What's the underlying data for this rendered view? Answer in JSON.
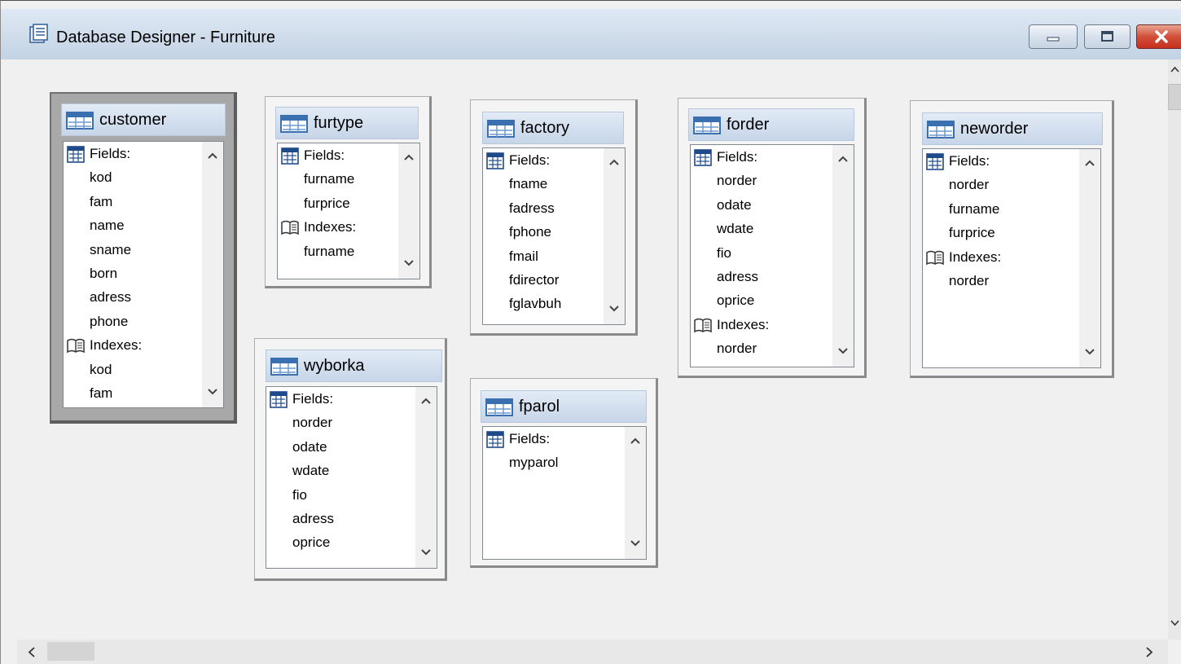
{
  "window": {
    "title": "Database Designer - Furniture"
  },
  "icons": {
    "window": "database-designer-icon",
    "table": "table-grid-icon",
    "fields": "fields-grid-icon",
    "indexes": "book-index-icon",
    "scroll_up": "chevron-up-icon",
    "scroll_down": "chevron-down-icon"
  },
  "colors": {
    "header": "#c6d5e8",
    "selected_frame": "#a8a8a8",
    "close": "#c6301e"
  },
  "tables": [
    {
      "name": "customer",
      "selected": true,
      "fields": [
        "kod",
        "fam",
        "name",
        "sname",
        "born",
        "adress",
        "phone"
      ],
      "indexes": [
        "kod",
        "fam"
      ]
    },
    {
      "name": "furtype",
      "selected": false,
      "fields": [
        "furname",
        "furprice"
      ],
      "indexes": [
        "furname"
      ]
    },
    {
      "name": "factory",
      "selected": false,
      "fields": [
        "fname",
        "fadress",
        "fphone",
        "fmail",
        "fdirector",
        "fglavbuh"
      ],
      "indexes": []
    },
    {
      "name": "forder",
      "selected": false,
      "fields": [
        "norder",
        "odate",
        "wdate",
        "fio",
        "adress",
        "oprice"
      ],
      "indexes": [
        "norder"
      ]
    },
    {
      "name": "neworder",
      "selected": false,
      "fields": [
        "norder",
        "furname",
        "furprice"
      ],
      "indexes": [
        "norder"
      ]
    },
    {
      "name": "wyborka",
      "selected": false,
      "fields": [
        "norder",
        "odate",
        "wdate",
        "fio",
        "adress",
        "oprice"
      ],
      "indexes": []
    },
    {
      "name": "fparol",
      "selected": false,
      "fields": [
        "myparol"
      ],
      "indexes": []
    }
  ],
  "labels": {
    "fields": "Fields:",
    "indexes": "Indexes:"
  }
}
